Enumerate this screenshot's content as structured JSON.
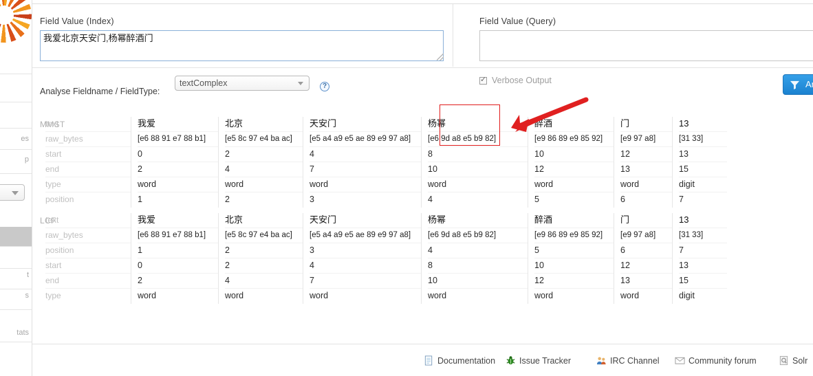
{
  "sidebar": {
    "logo_icon": "solr-sunburst-logo",
    "clipped_items": [
      {
        "label": "es"
      },
      {
        "label": "p"
      },
      {
        "label": "t"
      },
      {
        "label": "s"
      },
      {
        "label": "tats"
      }
    ],
    "core_selector_icon": "chevron-down-icon"
  },
  "index_panel": {
    "label": "Field Value (Index)",
    "value": "我爱北京天安门,杨幂醉酒门",
    "placeholder": ""
  },
  "query_panel": {
    "label": "Field Value (Query)",
    "value": "",
    "placeholder": ""
  },
  "controls": {
    "analyse_label": "Analyse Fieldname / FieldType:",
    "fieldtype_value": "textComplex",
    "fieldtype_options": [
      "textComplex"
    ],
    "help_icon": "question-mark-icon",
    "verbose_label": "Verbose Output",
    "verbose_checked": true,
    "analyse_button_label": "Analyse Values",
    "analyse_button_icon": "funnel-icon",
    "accent_color": "#1b82d0"
  },
  "annotation": {
    "rect_color": "#e01b1b",
    "arrow_color": "#e02020",
    "highlight_token": "杨幂"
  },
  "results": {
    "analyzers": [
      {
        "name": "MMST",
        "keys": [
          "text",
          "raw_bytes",
          "start",
          "end",
          "type",
          "position"
        ],
        "tokens": [
          {
            "text": "我爱",
            "raw_bytes": "[e6 88 91 e7 88 b1]",
            "start": "0",
            "end": "2",
            "type": "word",
            "position": "1"
          },
          {
            "text": "北京",
            "raw_bytes": "[e5 8c 97 e4 ba ac]",
            "start": "2",
            "end": "4",
            "type": "word",
            "position": "2"
          },
          {
            "text": "天安门",
            "raw_bytes": "[e5 a4 a9 e5 ae 89 e9 97 a8]",
            "start": "4",
            "end": "7",
            "type": "word",
            "position": "3"
          },
          {
            "text": "杨幂",
            "raw_bytes": "[e6 9d a8 e5 b9 82]",
            "start": "8",
            "end": "10",
            "type": "word",
            "position": "4"
          },
          {
            "text": "醉酒",
            "raw_bytes": "[e9 86 89 e9 85 92]",
            "start": "10",
            "end": "12",
            "type": "word",
            "position": "5"
          },
          {
            "text": "门",
            "raw_bytes": "[e9 97 a8]",
            "start": "12",
            "end": "13",
            "type": "word",
            "position": "6"
          },
          {
            "text": "13",
            "raw_bytes": "[31 33]",
            "start": "13",
            "end": "15",
            "type": "digit",
            "position": "7"
          }
        ]
      },
      {
        "name": "LCF",
        "keys": [
          "text",
          "raw_bytes",
          "position",
          "start",
          "end",
          "type"
        ],
        "tokens": [
          {
            "text": "我爱",
            "raw_bytes": "[e6 88 91 e7 88 b1]",
            "position": "1",
            "start": "0",
            "end": "2",
            "type": "word"
          },
          {
            "text": "北京",
            "raw_bytes": "[e5 8c 97 e4 ba ac]",
            "position": "2",
            "start": "2",
            "end": "4",
            "type": "word"
          },
          {
            "text": "天安门",
            "raw_bytes": "[e5 a4 a9 e5 ae 89 e9 97 a8]",
            "position": "3",
            "start": "4",
            "end": "7",
            "type": "word"
          },
          {
            "text": "杨幂",
            "raw_bytes": "[e6 9d a8 e5 b9 82]",
            "position": "4",
            "start": "8",
            "end": "10",
            "type": "word"
          },
          {
            "text": "醉酒",
            "raw_bytes": "[e9 86 89 e9 85 92]",
            "position": "5",
            "start": "10",
            "end": "12",
            "type": "word"
          },
          {
            "text": "门",
            "raw_bytes": "[e9 97 a8]",
            "position": "6",
            "start": "12",
            "end": "13",
            "type": "word"
          },
          {
            "text": "13",
            "raw_bytes": "[31 33]",
            "position": "7",
            "start": "13",
            "end": "15",
            "type": "digit"
          }
        ]
      }
    ]
  },
  "footer": {
    "items": [
      {
        "label": "Documentation",
        "icon": "document-icon"
      },
      {
        "label": "Issue Tracker",
        "icon": "bug-icon"
      },
      {
        "label": "IRC Channel",
        "icon": "people-icon"
      },
      {
        "label": "Community forum",
        "icon": "envelope-icon"
      },
      {
        "label": "Solr",
        "icon": "solr-query-icon"
      }
    ]
  }
}
